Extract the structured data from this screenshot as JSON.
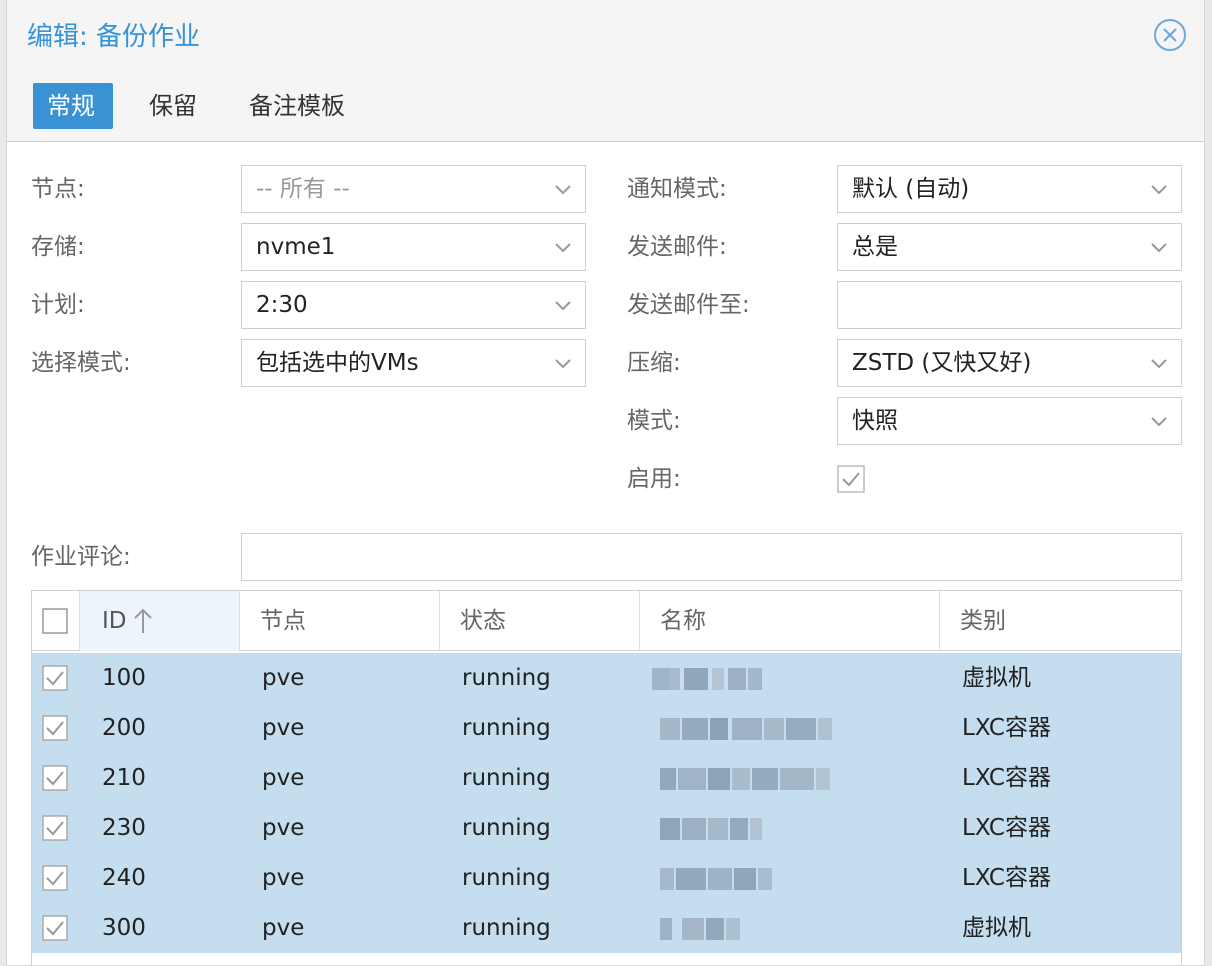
{
  "dialog": {
    "title": "编辑: 备份作业",
    "close_icon": "close-circle-icon"
  },
  "tabs": [
    {
      "label": "常规",
      "active": true
    },
    {
      "label": "保留",
      "active": false
    },
    {
      "label": "备注模板",
      "active": false
    }
  ],
  "form": {
    "node": {
      "label": "节点:",
      "value": "-- 所有 --"
    },
    "storage": {
      "label": "存储:",
      "value": "nvme1"
    },
    "schedule": {
      "label": "计划:",
      "value": "2:30"
    },
    "selection_mode": {
      "label": "选择模式:",
      "value": "包括选中的VMs"
    },
    "notification_mode": {
      "label": "通知模式:",
      "value": "默认 (自动)"
    },
    "send_email": {
      "label": "发送邮件:",
      "value": "总是"
    },
    "send_email_to": {
      "label": "发送邮件至:",
      "value": ""
    },
    "compression": {
      "label": "压缩:",
      "value": "ZSTD (又快又好)"
    },
    "mode": {
      "label": "模式:",
      "value": "快照"
    },
    "enabled": {
      "label": "启用:",
      "checked": true
    },
    "job_comment": {
      "label": "作业评论:",
      "value": ""
    }
  },
  "grid": {
    "columns": [
      "ID",
      "节点",
      "状态",
      "名称",
      "类别"
    ],
    "sorted_column": "ID",
    "rows": [
      {
        "id": "100",
        "node": "pve",
        "status": "running",
        "type": "虚拟机",
        "checked": true
      },
      {
        "id": "200",
        "node": "pve",
        "status": "running",
        "type": "LXC容器",
        "checked": true
      },
      {
        "id": "210",
        "node": "pve",
        "status": "running",
        "type": "LXC容器",
        "checked": true
      },
      {
        "id": "230",
        "node": "pve",
        "status": "running",
        "type": "LXC容器",
        "checked": true
      },
      {
        "id": "240",
        "node": "pve",
        "status": "running",
        "type": "LXC容器",
        "checked": true
      },
      {
        "id": "300",
        "node": "pve",
        "status": "running",
        "type": "虚拟机",
        "checked": true
      }
    ]
  },
  "colors": {
    "accent": "#3892d4",
    "selected_row": "#c4ddef"
  }
}
